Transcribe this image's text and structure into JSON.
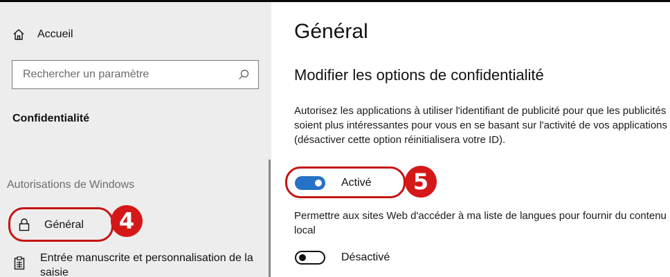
{
  "sidebar": {
    "home_label": "Accueil",
    "search_placeholder": "Rechercher un paramètre",
    "heading": "Confidentialité",
    "section_label": "Autorisations de Windows",
    "items": [
      {
        "label": "Général",
        "icon": "lock-icon"
      },
      {
        "label": "Entrée manuscrite et personnalisation de la saisie",
        "icon": "clipboard-icon"
      }
    ]
  },
  "main": {
    "title": "Général",
    "subtitle": "Modifier les options de confidentialité",
    "settings": [
      {
        "description": "Autorisez les applications à utiliser l'identifiant de publicité pour que les publicités soient plus intéressantes pour vous en se basant sur l'activité de vos applications (désactiver cette option réinitialisera votre ID).",
        "state_label": "Activé",
        "enabled": true
      },
      {
        "description": "Permettre aux sites Web d'accéder à ma liste de langues pour fournir du contenu local",
        "state_label": "Désactivé",
        "enabled": false
      }
    ]
  },
  "annotations": {
    "badge_sidebar": "4",
    "badge_toggle": "5"
  },
  "colors": {
    "accent": "#2572c6",
    "highlight": "#c41414",
    "badge": "#d41818",
    "sidebar_bg": "#ededed"
  }
}
